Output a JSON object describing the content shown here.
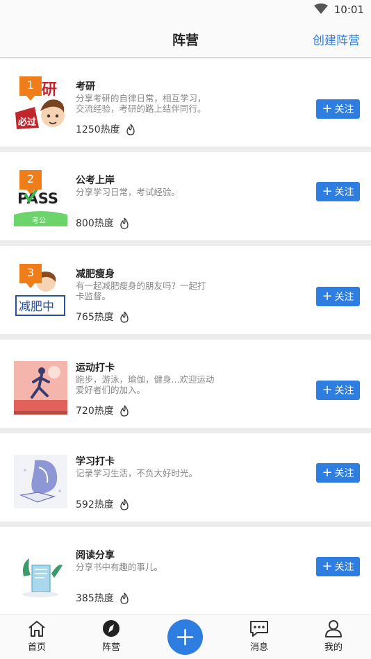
{
  "status_bar": {
    "time": "10:01",
    "wifi_icon": "wifi-icon"
  },
  "header": {
    "title": "阵营",
    "create_label": "创建阵营"
  },
  "camps": [
    {
      "rank": "1",
      "name": "考研",
      "desc_lines": [
        "分享考研的自律日常，相互学习，",
        "交流经验，考研的路上结伴同行。"
      ],
      "heat": "1250热度",
      "follow_label": "关注",
      "image_label": "研 必过"
    },
    {
      "rank": "2",
      "name": "公考上岸",
      "desc_lines": [
        "分享学习日常，考试经验。"
      ],
      "heat": "800热度",
      "follow_label": "关注",
      "image_label": "PASS 考公"
    },
    {
      "rank": "3",
      "name": "减肥瘦身",
      "desc_lines": [
        "有一起减肥瘦身的朋友吗？一起打",
        "卡监督。"
      ],
      "heat": "765热度",
      "follow_label": "关注",
      "image_label": "减肥中"
    },
    {
      "rank": "",
      "name": "运动打卡",
      "desc_lines": [
        "跑步，游泳，瑜伽，健身...欢迎运动",
        "爱好者们的加入。"
      ],
      "heat": "720热度",
      "follow_label": "关注",
      "image_label": ""
    },
    {
      "rank": "",
      "name": "学习打卡",
      "desc_lines": [
        "记录学习生活，不负大好时光。"
      ],
      "heat": "592热度",
      "follow_label": "关注",
      "image_label": ""
    },
    {
      "rank": "",
      "name": "阅读分享",
      "desc_lines": [
        "分享书中有趣的事儿。"
      ],
      "heat": "385热度",
      "follow_label": "关注",
      "image_label": ""
    }
  ],
  "tabbar": {
    "home": {
      "label": "首页",
      "icon": "home-icon"
    },
    "camp": {
      "label": "阵营",
      "icon": "compass-icon"
    },
    "add": {
      "icon": "plus-icon"
    },
    "messages": {
      "label": "消息",
      "icon": "chat-icon"
    },
    "mine": {
      "label": "我的",
      "icon": "user-icon"
    }
  },
  "colors": {
    "accent": "#2e7de0",
    "rank_badge": "#ef7d1a"
  }
}
